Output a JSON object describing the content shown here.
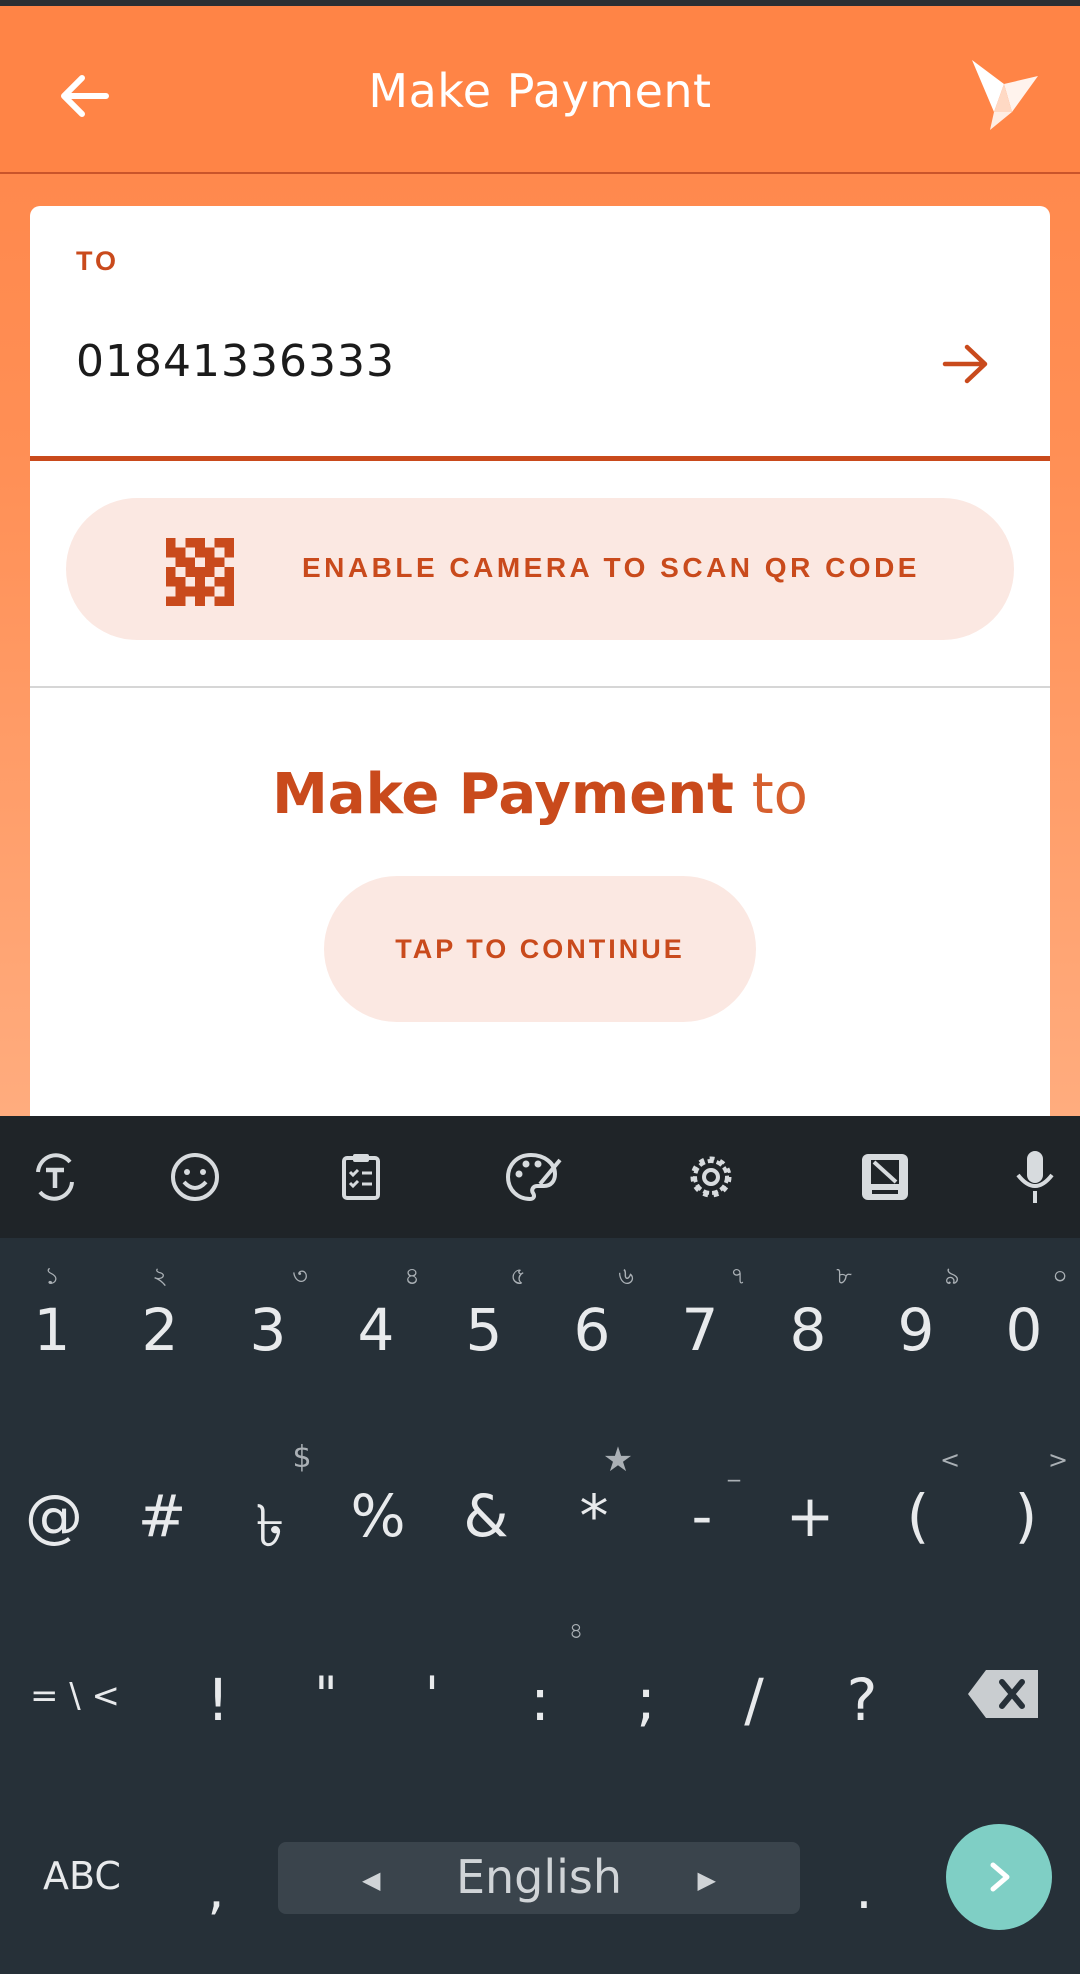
{
  "app": {
    "title": "Make Payment",
    "back_icon": "arrow-left-icon",
    "logo_icon": "paper-bird-logo-icon"
  },
  "form": {
    "to_label": "TO",
    "phone_value": "01841336333",
    "go_icon": "arrow-right-icon",
    "qr_button_label": "ENABLE CAMERA TO SCAN QR CODE",
    "qr_icon": "qr-code-icon"
  },
  "summary": {
    "heading_strong": "Make Payment",
    "heading_weak": " to",
    "continue_label": "TAP TO CONTINUE"
  },
  "keyboard": {
    "toolbar_icons": [
      "translate-icon",
      "emoji-icon",
      "clipboard-icon",
      "palette-icon",
      "settings-icon",
      "news-icon",
      "microphone-icon"
    ],
    "number_row": [
      {
        "main": "1",
        "hint": "১"
      },
      {
        "main": "2",
        "hint": "২"
      },
      {
        "main": "3",
        "hint": "৩"
      },
      {
        "main": "4",
        "hint": "৪"
      },
      {
        "main": "5",
        "hint": "৫"
      },
      {
        "main": "6",
        "hint": "৬"
      },
      {
        "main": "7",
        "hint": "৭"
      },
      {
        "main": "8",
        "hint": "৮"
      },
      {
        "main": "9",
        "hint": "৯"
      },
      {
        "main": "0",
        "hint": "০"
      }
    ],
    "symbol_row": [
      {
        "main": "@",
        "hint": ""
      },
      {
        "main": "#",
        "hint": ""
      },
      {
        "main": "৳",
        "hint": "$"
      },
      {
        "main": "%",
        "hint": ""
      },
      {
        "main": "&",
        "hint": ""
      },
      {
        "main": "*",
        "hint": "★"
      },
      {
        "main": "-",
        "hint": "_"
      },
      {
        "main": "+",
        "hint": ""
      },
      {
        "main": "(",
        "hint": "<"
      },
      {
        "main": ")",
        "hint": ">"
      }
    ],
    "punct_row": [
      {
        "main": "= \\ <",
        "hint": ""
      },
      {
        "main": "!",
        "hint": ""
      },
      {
        "main": "\"",
        "hint": ""
      },
      {
        "main": "'",
        "hint": ""
      },
      {
        "main": ":",
        "hint": ""
      },
      {
        "main": ";",
        "hint": "৪"
      },
      {
        "main": "/",
        "hint": ""
      },
      {
        "main": "?",
        "hint": ""
      }
    ],
    "backspace_icon": "backspace-icon",
    "abc_label": "ABC",
    "comma_label": ",",
    "space_label": "English",
    "period_label": ".",
    "enter_icon": "chevron-right-icon"
  },
  "colors": {
    "brand_orange": "#ff8446",
    "accent_red": "#c94a1c",
    "button_tint": "#fbe8e2",
    "keyboard_bg": "#263038",
    "enter_teal": "#7fcfc5"
  }
}
